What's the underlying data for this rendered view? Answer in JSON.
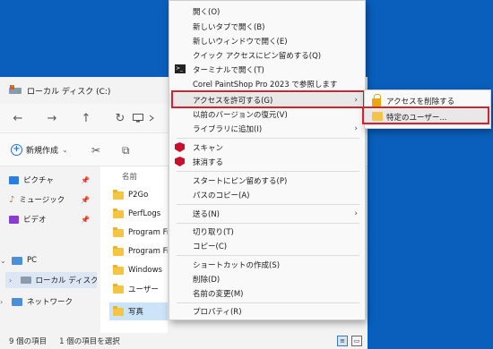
{
  "explorer": {
    "tab_title": "ローカル ディスク (C:)",
    "nav": {
      "back": "←",
      "forward": "→",
      "up": "↑",
      "refresh": "↻"
    },
    "toolbar": {
      "new_label": "新規作成"
    },
    "sidebar": {
      "quick": [
        {
          "label": "ピクチャ",
          "icon": "pictures-icon",
          "color": "#2a7de1"
        },
        {
          "label": "ミュージック",
          "icon": "music-icon",
          "color": "#e45c3a"
        },
        {
          "label": "ビデオ",
          "icon": "video-icon",
          "color": "#8a3bd1"
        }
      ],
      "pc_label": "PC",
      "local_disk_label": "ローカル ディスク",
      "network_label": "ネットワーク"
    },
    "column_name": "名前",
    "files": [
      "P2Go",
      "PerfLogs",
      "Program Files",
      "Program Files (x86)",
      "Windows",
      "ユーザー",
      "写真"
    ],
    "selected_file": "写真",
    "status": {
      "items": "9 個の項目",
      "selected": "1 個の項目を選択"
    }
  },
  "context_menu": {
    "top_items": [
      "開く(O)",
      "新しいタブで開く(B)",
      "新しいウィンドウで開く(E)",
      "クイック アクセスにピン留めする(Q)",
      "ターミナルで開く(T)",
      "Corel PaintShop Pro 2023 で参照します"
    ],
    "access_item": "アクセスを許可する(G)",
    "mid_items": [
      "以前のバージョンの復元(V)",
      "ライブラリに追加(I)"
    ],
    "mcafee_items": [
      "スキャン",
      "抹消する"
    ],
    "pin_items": [
      "スタートにピン留めする(P)",
      "パスのコピー(A)"
    ],
    "send_item": "送る(N)",
    "edit_items": [
      "切り取り(T)",
      "コピー(C)"
    ],
    "file_items": [
      "ショートカットの作成(S)",
      "削除(D)",
      "名前の変更(M)"
    ],
    "properties": "プロパティ(R)"
  },
  "submenu": {
    "remove_access": "アクセスを削除する",
    "specific_user": "特定のユーザー..."
  },
  "colors": {
    "desktop": "#0a5fbd",
    "highlight": "#d4232e",
    "mcafee": "#c8102e"
  }
}
